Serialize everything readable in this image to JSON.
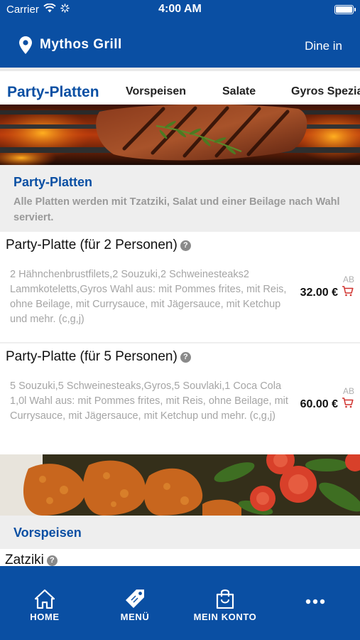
{
  "status_bar": {
    "carrier": "Carrier",
    "time": "4:00 AM"
  },
  "header": {
    "store_name": "Mythos Grill",
    "mode": "Dine in"
  },
  "tabs": [
    {
      "label": "Party-Platten",
      "active": true
    },
    {
      "label": "Vorspeisen",
      "active": false
    },
    {
      "label": "Salate",
      "active": false
    },
    {
      "label": "Gyros Spezialitäten",
      "active": false
    }
  ],
  "sections": [
    {
      "title": "Party-Platten",
      "description": "Alle Platten werden mit Tzatziki, Salat und einer Beilage nach Wahl serviert.",
      "items": [
        {
          "name": "Party-Platte (für 2 Personen)",
          "description": "2 Hähnchenbrustfilets,2 Souzuki,2 Schweinesteaks2 Lammkoteletts,Gyros Wahl aus: mit Pommes frites, mit Reis, ohne Beilage, mit Currysauce, mit Jägersauce, mit Ketchup und mehr. (c,g,j)",
          "price_prefix": "AB",
          "price": "32.00 €"
        },
        {
          "name": "Party-Platte (für 5 Personen)",
          "description": "5 Souzuki,5 Schweinesteaks,Gyros,5 Souvlaki,1 Coca Cola 1,0l Wahl aus: mit Pommes frites, mit Reis, ohne Beilage, mit Currysauce, mit Jägersauce, mit Ketchup und mehr. (c,g,j)",
          "price_prefix": "AB",
          "price": "60.00 €"
        }
      ]
    },
    {
      "title": "Vorspeisen",
      "items": [
        {
          "name": "Zatziki"
        }
      ]
    }
  ],
  "bottom_nav": [
    {
      "label": "HOME",
      "icon": "home-icon"
    },
    {
      "label": "MENÜ",
      "icon": "tag-icon"
    },
    {
      "label": "MEIN KONTO",
      "icon": "shopping-bag-icon"
    },
    {
      "label": "",
      "icon": "more-icon"
    }
  ],
  "colors": {
    "brand": "#0a4fa3",
    "cart": "#d0312d",
    "section_bg": "#eeeeee"
  }
}
